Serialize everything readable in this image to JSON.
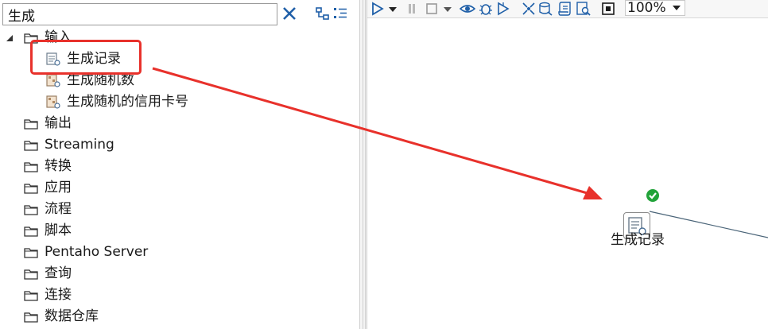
{
  "search": {
    "value": "生成"
  },
  "tree": {
    "input_folder": "输入",
    "input_children": [
      "生成记录",
      "生成随机数",
      "生成随机的信用卡号"
    ],
    "folders": [
      "输出",
      "Streaming",
      "转换",
      "应用",
      "流程",
      "脚本",
      "Pentaho Server",
      "查询",
      "连接",
      "数据仓库"
    ]
  },
  "toolbar": {
    "zoom": "100%"
  },
  "canvas": {
    "step_name": "生成记录"
  },
  "colors": {
    "highlight": "#e8312b",
    "arrow": "#e8312b",
    "ok_badge": "#22a33a",
    "accent_blue": "#1f5fa8"
  }
}
